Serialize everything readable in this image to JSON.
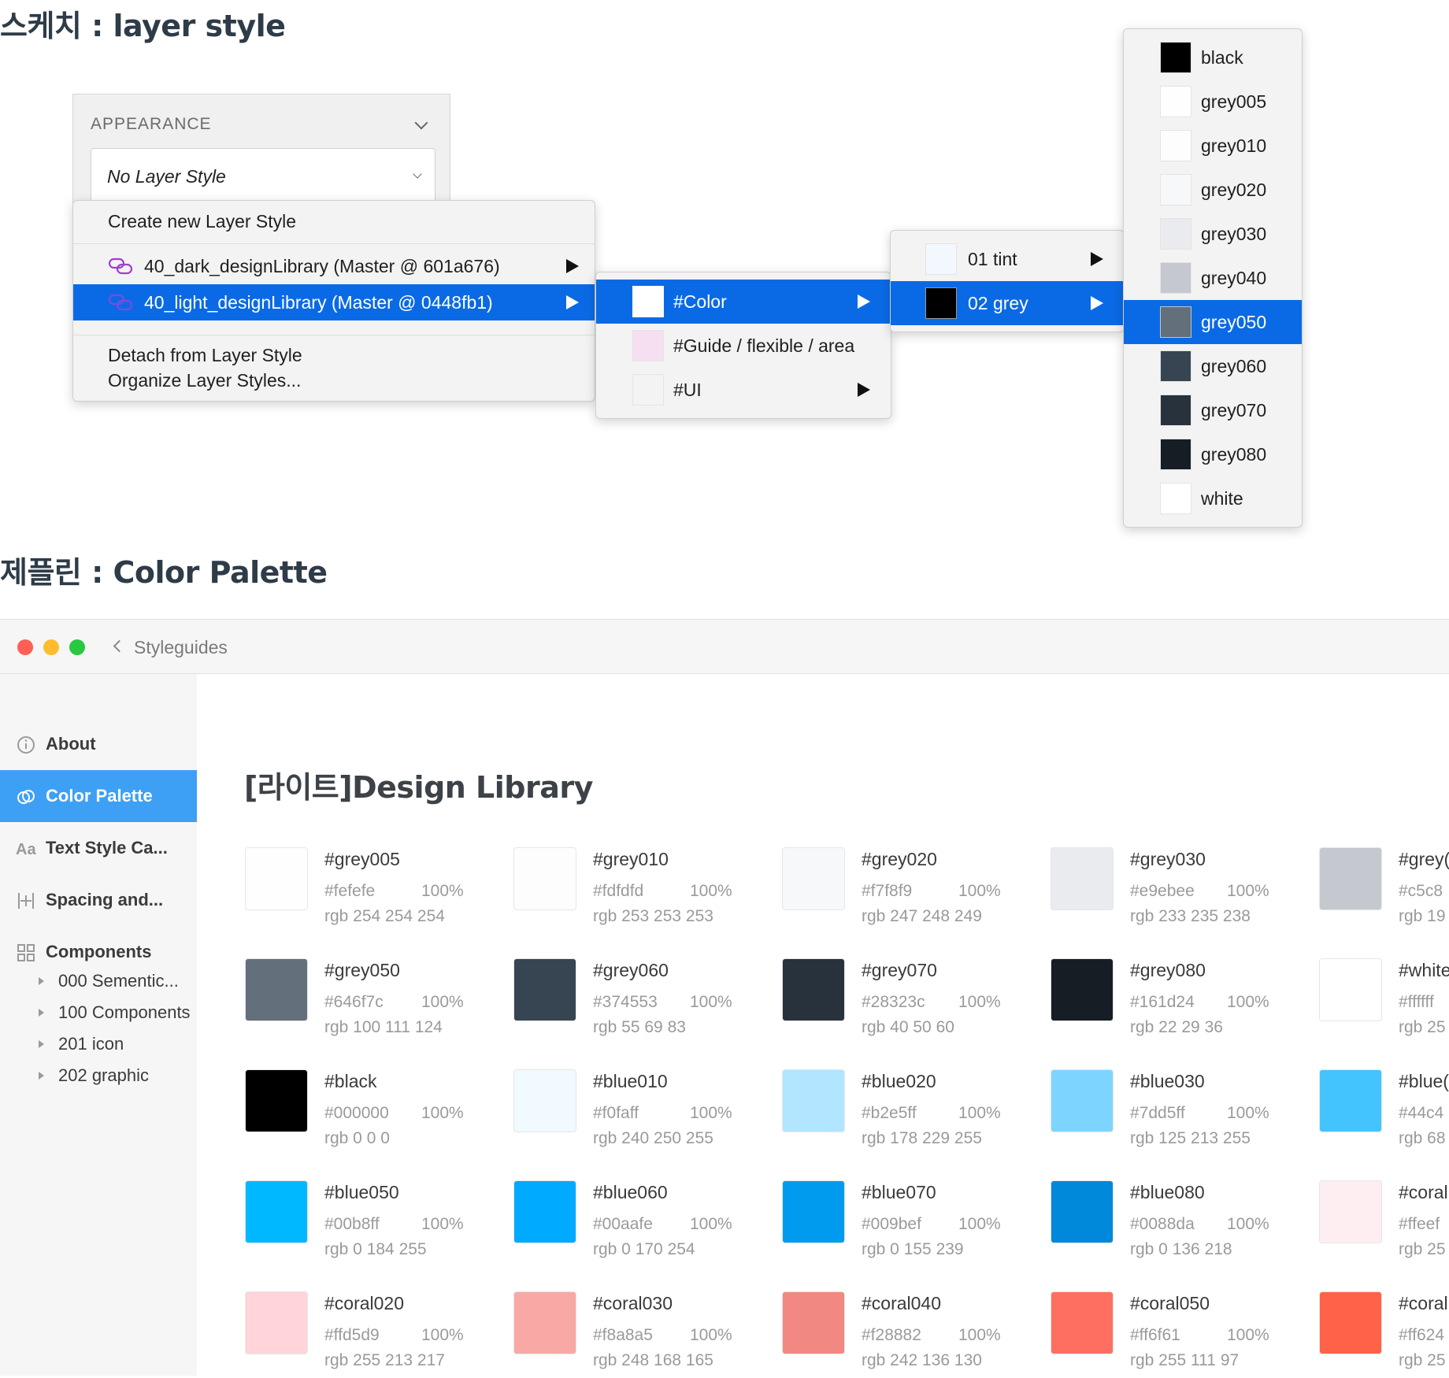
{
  "sketch": {
    "title": "스케치 : layer style",
    "appearance_header": "APPEARANCE",
    "layer_style_value": "No Layer Style",
    "menu1": {
      "create": "Create new Layer Style",
      "libraries": [
        {
          "label": "40_dark_designLibrary (Master @ 601a676)",
          "selected": false
        },
        {
          "label": "40_light_designLibrary (Master @ 0448fb1)",
          "selected": true
        }
      ],
      "detach": "Detach from Layer Style",
      "organize": "Organize Layer Styles..."
    },
    "menu2": [
      {
        "label": "#Color",
        "color": "#ffffff",
        "selected": true,
        "submenu": true
      },
      {
        "label": "#Guide / flexible / area",
        "color": "#f5dff0",
        "selected": false,
        "submenu": false
      },
      {
        "label": "#UI",
        "color": "#f3f3f3",
        "selected": false,
        "submenu": true
      }
    ],
    "menu3": [
      {
        "label": "01 tint",
        "color": "#f2f8fd",
        "selected": false
      },
      {
        "label": "02 grey",
        "color": "#000000",
        "selected": true
      }
    ],
    "menu4": [
      {
        "label": "black",
        "color": "#000000",
        "selected": false
      },
      {
        "label": "grey005",
        "color": "#fefefe",
        "selected": false
      },
      {
        "label": "grey010",
        "color": "#fdfdfd",
        "selected": false
      },
      {
        "label": "grey020",
        "color": "#f7f8f9",
        "selected": false
      },
      {
        "label": "grey030",
        "color": "#e9ebee",
        "selected": false
      },
      {
        "label": "grey040",
        "color": "#c5c8ce",
        "selected": false
      },
      {
        "label": "grey050",
        "color": "#646f7c",
        "selected": true
      },
      {
        "label": "grey060",
        "color": "#374553",
        "selected": false
      },
      {
        "label": "grey070",
        "color": "#28323c",
        "selected": false
      },
      {
        "label": "grey080",
        "color": "#161d24",
        "selected": false
      },
      {
        "label": "white",
        "color": "#ffffff",
        "selected": false
      }
    ],
    "accent_color": "#0a6ae6"
  },
  "zeplin": {
    "title": "제플린 : Color Palette",
    "breadcrumb": "Styleguides",
    "traffic_lights": [
      "#fe5f57",
      "#febc2e",
      "#28c840"
    ],
    "sidebar": [
      {
        "label": "About",
        "icon": "info-icon",
        "active": false
      },
      {
        "label": "Color Palette",
        "icon": "color-palette-icon",
        "active": true
      },
      {
        "label": "Text Style Ca...",
        "icon": "text-style-icon",
        "active": false
      },
      {
        "label": "Spacing and...",
        "icon": "spacing-icon",
        "active": false
      },
      {
        "label": "Components",
        "icon": "components-icon",
        "active": false
      }
    ],
    "component_tree": [
      "000 Sementic...",
      "100 Components",
      "201  icon",
      "202 graphic"
    ],
    "library_title": "[라이트]Design Library",
    "colors": [
      {
        "name": "#grey005",
        "hex": "#fefefe",
        "opacity": "100%",
        "rgb": "rgb 254 254 254",
        "color": "#fefefe"
      },
      {
        "name": "#grey010",
        "hex": "#fdfdfd",
        "opacity": "100%",
        "rgb": "rgb 253 253 253",
        "color": "#fdfdfd"
      },
      {
        "name": "#grey020",
        "hex": "#f7f8f9",
        "opacity": "100%",
        "rgb": "rgb 247 248 249",
        "color": "#f7f8f9"
      },
      {
        "name": "#grey030",
        "hex": "#e9ebee",
        "opacity": "100%",
        "rgb": "rgb 233 235 238",
        "color": "#e9ebee"
      },
      {
        "name": "#grey(",
        "hex": "#c5c8",
        "opacity": "",
        "rgb": "rgb 19",
        "color": "#c5c8ce"
      },
      {
        "name": "#grey050",
        "hex": "#646f7c",
        "opacity": "100%",
        "rgb": "rgb 100 111 124",
        "color": "#646f7c"
      },
      {
        "name": "#grey060",
        "hex": "#374553",
        "opacity": "100%",
        "rgb": "rgb 55 69 83",
        "color": "#374553"
      },
      {
        "name": "#grey070",
        "hex": "#28323c",
        "opacity": "100%",
        "rgb": "rgb 40 50 60",
        "color": "#28323c"
      },
      {
        "name": "#grey080",
        "hex": "#161d24",
        "opacity": "100%",
        "rgb": "rgb 22 29 36",
        "color": "#161d24"
      },
      {
        "name": "#white",
        "hex": "#ffffff",
        "opacity": "",
        "rgb": "rgb 25",
        "color": "#ffffff"
      },
      {
        "name": "#black",
        "hex": "#000000",
        "opacity": "100%",
        "rgb": "rgb 0 0 0",
        "color": "#000000"
      },
      {
        "name": "#blue010",
        "hex": "#f0faff",
        "opacity": "100%",
        "rgb": "rgb 240 250 255",
        "color": "#f0faff"
      },
      {
        "name": "#blue020",
        "hex": "#b2e5ff",
        "opacity": "100%",
        "rgb": "rgb 178 229 255",
        "color": "#b2e5ff"
      },
      {
        "name": "#blue030",
        "hex": "#7dd5ff",
        "opacity": "100%",
        "rgb": "rgb 125 213 255",
        "color": "#7dd5ff"
      },
      {
        "name": "#blue(",
        "hex": "#44c4",
        "opacity": "",
        "rgb": "rgb 68",
        "color": "#44c4ff"
      },
      {
        "name": "#blue050",
        "hex": "#00b8ff",
        "opacity": "100%",
        "rgb": "rgb 0 184 255",
        "color": "#00b8ff"
      },
      {
        "name": "#blue060",
        "hex": "#00aafe",
        "opacity": "100%",
        "rgb": "rgb 0 170 254",
        "color": "#00aafe"
      },
      {
        "name": "#blue070",
        "hex": "#009bef",
        "opacity": "100%",
        "rgb": "rgb 0 155 239",
        "color": "#009bef"
      },
      {
        "name": "#blue080",
        "hex": "#0088da",
        "opacity": "100%",
        "rgb": "rgb 0 136 218",
        "color": "#0088da"
      },
      {
        "name": "#coral",
        "hex": "#ffeef",
        "opacity": "",
        "rgb": "rgb 25",
        "color": "#ffeef1"
      },
      {
        "name": "#coral020",
        "hex": "#ffd5d9",
        "opacity": "100%",
        "rgb": "rgb 255 213 217",
        "color": "#ffd5d9"
      },
      {
        "name": "#coral030",
        "hex": "#f8a8a5",
        "opacity": "100%",
        "rgb": "rgb 248 168 165",
        "color": "#f8a8a5"
      },
      {
        "name": "#coral040",
        "hex": "#f28882",
        "opacity": "100%",
        "rgb": "rgb 242 136 130",
        "color": "#f28882"
      },
      {
        "name": "#coral050",
        "hex": "#ff6f61",
        "opacity": "100%",
        "rgb": "rgb 255 111 97",
        "color": "#ff6f61"
      },
      {
        "name": "#coral",
        "hex": "#ff624",
        "opacity": "",
        "rgb": "rgb 25",
        "color": "#ff6248"
      }
    ]
  }
}
